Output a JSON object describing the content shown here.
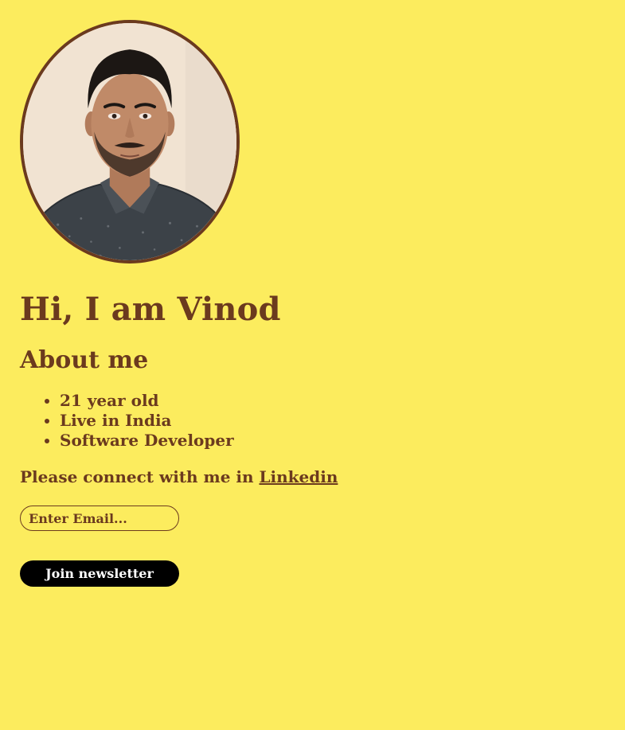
{
  "profile": {
    "heading": "Hi, I am Vinod"
  },
  "about": {
    "title": "About me",
    "items": [
      "21 year old",
      "Live in India",
      "Software Developer"
    ]
  },
  "connect": {
    "text": "Please connect with me in ",
    "link_label": "Linkedin"
  },
  "newsletter": {
    "email_placeholder": "Enter Email...",
    "button_label": "Join newsletter"
  },
  "colors": {
    "background": "#fcec5e",
    "text": "#6b3a1e",
    "button": "#000000",
    "button_text": "#ffffff"
  }
}
